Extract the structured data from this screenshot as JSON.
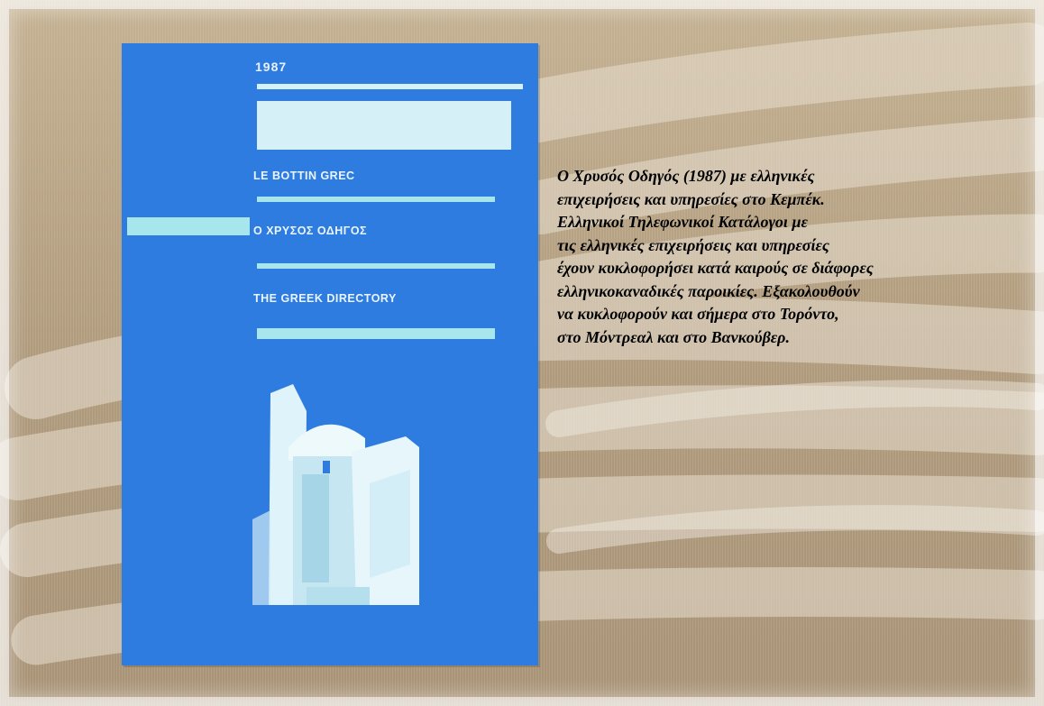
{
  "cover": {
    "year": "1987",
    "title_fr": "LE BOTTIN GREC",
    "title_gr": "Ο ΧΡΥΣΟΣ ΟΔΗΓΟΣ",
    "title_en": "THE GREEK DIRECTORY"
  },
  "caption": {
    "lines": [
      "Ο Χρυσός Οδηγός (1987) με ελληνικές",
      "επιχειρήσεις και υπηρεσίες στο Κεμπέκ.",
      "Ελληνικοί Τηλεφωνικοί Κατάλογοι με",
      "τις ελληνικές επιχειρήσεις και υπηρεσίες",
      "έχουν κυκλοφορήσει κατά καιρούς σε διάφορες",
      "ελληνικοκαναδικές παροικίες. Εξακολουθούν",
      "να κυκλοφορούν και σήμερα στο Τορόντο,",
      "στο Μόντρεαλ και στο Βανκούβερ."
    ]
  },
  "colors": {
    "cover_blue": "#2f7ce0",
    "background_tan": "#b8a487",
    "stripe_light": "#d6f0f8"
  }
}
